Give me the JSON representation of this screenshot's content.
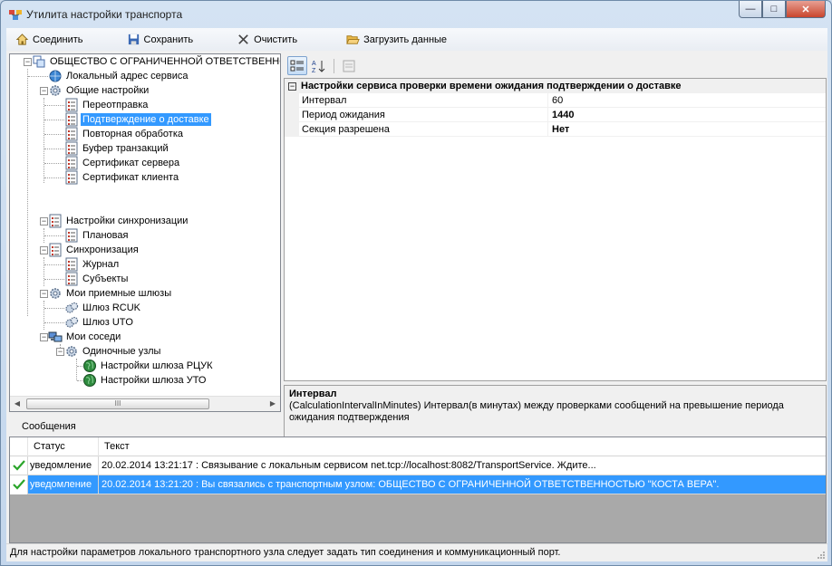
{
  "window": {
    "title": "Утилита настройки транспорта",
    "minimize": "—",
    "maximize": "□",
    "close": "✕"
  },
  "toolbar": {
    "connect": "Соединить",
    "save": "Сохранить",
    "clear": "Очистить",
    "load": "Загрузить данные"
  },
  "tree": {
    "root": "ОБЩЕСТВО С ОГРАНИЧЕННОЙ ОТВЕТСТВЕННОСТЬЮ",
    "local_address": "Локальный адрес сервиса",
    "general": "Общие настройки",
    "resend": "Переотправка",
    "delivery_confirm": "Подтверждение о доставке",
    "reprocess": "Повторная обработка",
    "tx_buffer": "Буфер транзакций",
    "server_cert": "Сертификат сервера",
    "client_cert": "Сертификат клиента",
    "sync_settings": "Настройки синхронизации",
    "scheduled": "Плановая",
    "sync": "Синхронизация",
    "journal": "Журнал",
    "subjects": "Субъекты",
    "gateways": "Мои приемные шлюзы",
    "gw_rcuk": "Шлюз RCUK",
    "gw_uto": "Шлюз UTO",
    "neighbors": "Мои соседи",
    "single_nodes": "Одиночные узлы",
    "gw_settings_rcuk": "Настройки шлюза РЦУК",
    "gw_settings_uto": "Настройки шлюза УТО",
    "scroll_thumb": "III"
  },
  "properties": {
    "category": "Настройки сервиса проверки времени ожидания подтверждении о доставке",
    "rows": [
      {
        "name": "Интервал",
        "value": "60"
      },
      {
        "name": "Период ожидания",
        "value": "1440"
      },
      {
        "name": "Секция разрешена",
        "value": "Нет"
      }
    ],
    "desc_title": "Интервал",
    "desc_text": "(CalculationIntervalInMinutes) Интервал(в минутах) между проверками сообщений на превышение периода ожидания подтверждения"
  },
  "messages": {
    "title": "Сообщения",
    "col_status": "Статус",
    "col_text": "Текст",
    "rows": [
      {
        "status": "уведомление",
        "text": "20.02.2014 13:21:17 : Связывание с локальным сервисом net.tcp://localhost:8082/TransportService. Ждите..."
      },
      {
        "status": "уведомление",
        "text": "20.02.2014 13:21:20 : Вы связались с транспортным узлом: ОБЩЕСТВО С ОГРАНИЧЕННОЙ ОТВЕТСТВЕННОСТЬЮ \"КОСТА ВЕРА\"."
      }
    ]
  },
  "statusbar": {
    "text": "Для настройки параметров локального транспортного узла следует задать тип соединения и коммуникационный порт."
  },
  "colors": {
    "selection": "#3399ff",
    "title_gradient": "#c3d6ec",
    "close_button": "#c9452d"
  }
}
